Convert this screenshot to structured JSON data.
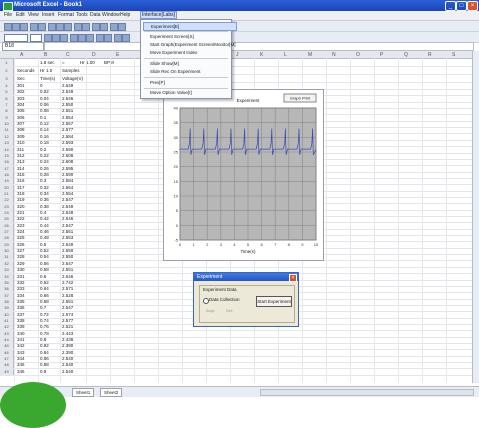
{
  "window": {
    "title": "Microsoft Excel - Book1"
  },
  "menubar": {
    "items": [
      "File",
      "Edit",
      "View",
      "Insert",
      "Format",
      "Tools",
      "Data",
      "Window",
      "Help",
      "Interface[Labs]"
    ]
  },
  "formula": {
    "namebox": "B18",
    "content": ""
  },
  "grid": {
    "columns": [
      "A",
      "B",
      "C",
      "D",
      "E",
      "F",
      "G",
      "H",
      "I",
      "J",
      "K",
      "L",
      "M",
      "N",
      "O",
      "P",
      "Q",
      "R",
      "S"
    ],
    "header_row": [
      "",
      "1.8 sec",
      "=",
      "",
      "Hr 1.00",
      "BPM"
    ],
    "label_row": [
      "Seconds",
      "Hr 1.0",
      "Samples"
    ],
    "unit_row": [
      "Sec",
      "Time(s)",
      "Voltage(V)"
    ],
    "rows": [
      [
        "301",
        "0",
        "2.549"
      ],
      [
        "302",
        "0.02",
        "2.549"
      ],
      [
        "303",
        "0.04",
        "2.546"
      ],
      [
        "304",
        "0.06",
        "2.550"
      ],
      [
        "305",
        "0.08",
        "2.551"
      ],
      [
        "306",
        "0.1",
        "2.554"
      ],
      [
        "307",
        "0.12",
        "2.557"
      ],
      [
        "308",
        "0.14",
        "2.577"
      ],
      [
        "309",
        "0.16",
        "2.584"
      ],
      [
        "310",
        "0.18",
        "2.593"
      ],
      [
        "311",
        "0.2",
        "2.590"
      ],
      [
        "312",
        "0.22",
        "2.608"
      ],
      [
        "313",
        "0.24",
        "2.608"
      ],
      [
        "314",
        "0.26",
        "2.595"
      ],
      [
        "315",
        "0.28",
        "2.590"
      ],
      [
        "316",
        "0.3",
        "2.584"
      ],
      [
        "317",
        "0.32",
        "2.564"
      ],
      [
        "318",
        "0.34",
        "2.554"
      ],
      [
        "319",
        "0.36",
        "2.547"
      ],
      [
        "320",
        "0.38",
        "2.549"
      ],
      [
        "321",
        "0.4",
        "2.548"
      ],
      [
        "322",
        "0.42",
        "2.546"
      ],
      [
        "323",
        "0.44",
        "2.547"
      ],
      [
        "324",
        "0.46",
        "2.551"
      ],
      [
        "325",
        "0.48",
        "2.553"
      ],
      [
        "326",
        "0.5",
        "2.549"
      ],
      [
        "327",
        "0.52",
        "2.550"
      ],
      [
        "328",
        "0.54",
        "2.550"
      ],
      [
        "329",
        "0.56",
        "2.547"
      ],
      [
        "330",
        "0.58",
        "2.551"
      ],
      [
        "331",
        "0.6",
        "2.546"
      ],
      [
        "332",
        "0.62",
        "2.742"
      ],
      [
        "333",
        "0.64",
        "2.571"
      ],
      [
        "334",
        "0.66",
        "2.528"
      ],
      [
        "335",
        "0.68",
        "2.551"
      ],
      [
        "336",
        "0.7",
        "2.547"
      ],
      [
        "337",
        "0.72",
        "2.574"
      ],
      [
        "338",
        "0.74",
        "2.577"
      ],
      [
        "339",
        "0.76",
        "2.521"
      ],
      [
        "340",
        "0.78",
        "2.443"
      ],
      [
        "341",
        "0.8",
        "2.438"
      ],
      [
        "342",
        "0.82",
        "2.390"
      ],
      [
        "343",
        "0.84",
        "2.390"
      ],
      [
        "344",
        "0.86",
        "2.540"
      ],
      [
        "345",
        "0.88",
        "2.540"
      ],
      [
        "346",
        "0.9",
        "2.540"
      ]
    ]
  },
  "dropdown": {
    "items": [
      "Experiment[E]",
      "Experiment Screen[S]",
      "Start Graph(Experiment Screen/Monitor[M]",
      "Move Experiment Index",
      "Slide Show[M]",
      "Slide Rec On Experiment",
      "Prev[P]",
      "Move Option Value[I]"
    ],
    "selected_index": 0
  },
  "chart": {
    "legend": "Experiment",
    "legend_box": "Graph Print",
    "x_axis_title": "Time(s)"
  },
  "chart_data": {
    "type": "line",
    "title": "",
    "legend": [
      "Experiment"
    ],
    "x_ticks": [
      "0",
      "1",
      "2",
      "3",
      "4",
      "5",
      "6",
      "7",
      "8",
      "9",
      "10"
    ],
    "y_ticks": [
      "40",
      "35",
      "30",
      "25",
      "20",
      "15",
      "10",
      "5",
      "0",
      "-5"
    ],
    "xlim": [
      0,
      10
    ],
    "ylim": [
      -5,
      40
    ],
    "xlabel": "Time(s)",
    "series": [
      {
        "name": "Experiment",
        "points": [
          [
            0,
            26
          ],
          [
            0.6,
            26
          ],
          [
            0.7,
            28
          ],
          [
            0.75,
            33
          ],
          [
            0.8,
            24
          ],
          [
            0.9,
            26
          ],
          [
            1.6,
            26
          ],
          [
            1.7,
            28
          ],
          [
            1.75,
            33
          ],
          [
            1.8,
            24
          ],
          [
            1.9,
            26
          ],
          [
            2.6,
            26
          ],
          [
            2.7,
            28
          ],
          [
            2.75,
            33
          ],
          [
            2.8,
            24
          ],
          [
            2.9,
            26
          ],
          [
            3.6,
            26
          ],
          [
            3.7,
            28
          ],
          [
            3.75,
            33
          ],
          [
            3.8,
            24
          ],
          [
            3.9,
            26
          ],
          [
            4.6,
            26
          ],
          [
            4.7,
            28
          ],
          [
            4.75,
            33
          ],
          [
            4.8,
            24
          ],
          [
            4.9,
            26
          ],
          [
            5.6,
            26
          ],
          [
            5.7,
            28
          ],
          [
            5.75,
            33
          ],
          [
            5.8,
            24
          ],
          [
            5.9,
            26
          ],
          [
            6.6,
            26
          ],
          [
            6.7,
            28
          ],
          [
            6.75,
            33
          ],
          [
            6.8,
            24
          ],
          [
            6.9,
            26
          ],
          [
            7.6,
            26
          ],
          [
            7.7,
            28
          ],
          [
            7.75,
            33
          ],
          [
            7.8,
            24
          ],
          [
            7.9,
            26
          ],
          [
            8.6,
            26
          ],
          [
            8.7,
            28
          ],
          [
            8.75,
            33
          ],
          [
            8.8,
            24
          ],
          [
            8.9,
            26
          ],
          [
            9.6,
            26
          ],
          [
            9.7,
            28
          ],
          [
            9.75,
            33
          ],
          [
            9.8,
            24
          ],
          [
            10,
            26
          ]
        ]
      }
    ]
  },
  "dialog": {
    "title": "Experiment",
    "group_label": "Experiment Data",
    "radio_label": "Data Collection",
    "button_label": "Start Experiment",
    "sub_a": "Amp:",
    "sub_b": "Set:"
  },
  "statusbar": {
    "tabs": [
      "Sheet1",
      "Sheet2"
    ]
  },
  "colors": {
    "titlebar": "#2a5fd8",
    "highlight": "#cfe0ff",
    "plot_area": "#b7b7b7",
    "green_circle": "#3aa82f"
  }
}
